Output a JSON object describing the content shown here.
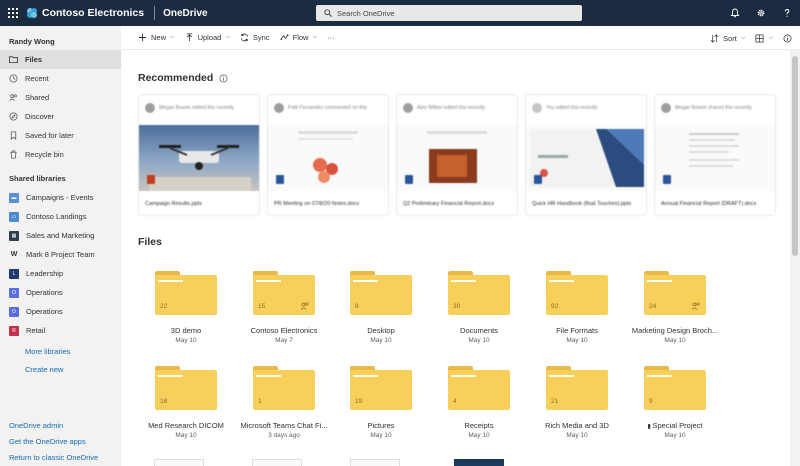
{
  "header": {
    "brand": "Contoso Electronics",
    "app": "OneDrive",
    "search_placeholder": "Search OneDrive",
    "bg_color": "#1b2b40"
  },
  "leftnav": {
    "user": "Randy Wong",
    "items": [
      {
        "label": "Files",
        "icon": "folder-icon",
        "active": true
      },
      {
        "label": "Recent",
        "icon": "clock-icon"
      },
      {
        "label": "Shared",
        "icon": "people-icon"
      },
      {
        "label": "Discover",
        "icon": "compass-icon"
      },
      {
        "label": "Saved for later",
        "icon": "bookmark-icon"
      },
      {
        "label": "Recycle bin",
        "icon": "recycle-bin-icon"
      }
    ],
    "shared_title": "Shared libraries",
    "libraries": [
      {
        "label": "Campaigns - Events",
        "color": "#5b8fd1"
      },
      {
        "label": "Contoso Landings",
        "color": "#4a8ccc"
      },
      {
        "label": "Sales and Marketing",
        "color": "#2d3e50"
      },
      {
        "label": "Mark 8 Project Team",
        "color": "#323130"
      },
      {
        "label": "Leadership",
        "color": "#1e3a6e"
      },
      {
        "label": "Operations",
        "color": "#5b6ee1"
      },
      {
        "label": "Operations",
        "color": "#5b6ee1"
      },
      {
        "label": "Retail",
        "color": "#c4314b"
      }
    ],
    "more_libraries": "More libraries",
    "create_new": "Create new",
    "bottom_links": [
      "OneDrive admin",
      "Get the OneDrive apps",
      "Return to classic OneDrive"
    ]
  },
  "commandbar": {
    "new": "New",
    "upload": "Upload",
    "sync": "Sync",
    "flow": "Flow",
    "more": "···",
    "sort": "Sort"
  },
  "recommended": {
    "title": "Recommended",
    "cards": [
      {
        "meta": "Megan Bowen edited this recently",
        "name": "Campaign Results.pptx",
        "accent": "#c43e1c"
      },
      {
        "meta": "Patti Fernandez commented on this",
        "name": "PR Meeting on 07/8/20 Notes.docx",
        "accent": "#2b579a"
      },
      {
        "meta": "Alex Wilber edited this recently",
        "name": "Q2 Preliminary Financial Report.docx",
        "accent": "#2b579a"
      },
      {
        "meta": "You edited this recently",
        "name": "Quick HR Handbook (final Touches).pptx",
        "accent": "#2b579a"
      },
      {
        "meta": "Megan Bowen shared this recently",
        "name": "Annual Financial Report (DRAFT).docx",
        "accent": "#2b579a"
      }
    ]
  },
  "files": {
    "title": "Files",
    "folders": [
      {
        "name": "3D demo",
        "date": "May 10",
        "count": "22",
        "shared": false
      },
      {
        "name": "Contoso Electronics",
        "date": "May 7",
        "count": "15",
        "shared": true
      },
      {
        "name": "Desktop",
        "date": "May 10",
        "count": "8",
        "shared": false
      },
      {
        "name": "Documents",
        "date": "May 10",
        "count": "30",
        "shared": false
      },
      {
        "name": "File Formats",
        "date": "May 10",
        "count": "92",
        "shared": false
      },
      {
        "name": "Marketing Design Broch...",
        "date": "May 10",
        "count": "24",
        "shared": true
      },
      {
        "name": "Med Research DICOM",
        "date": "May 10",
        "count": "18",
        "shared": false
      },
      {
        "name": "Microsoft Teams Chat Fi...",
        "date": "3 days ago",
        "count": "1",
        "shared": false
      },
      {
        "name": "Pictures",
        "date": "May 10",
        "count": "19",
        "shared": false
      },
      {
        "name": "Receipts",
        "date": "May 10",
        "count": "4",
        "shared": false
      },
      {
        "name": "Rich Media and 3D",
        "date": "May 10",
        "count": "21",
        "shared": false
      },
      {
        "name": "Special Project",
        "date": "May 10",
        "count": "9",
        "shared": false,
        "flag": true
      }
    ]
  }
}
